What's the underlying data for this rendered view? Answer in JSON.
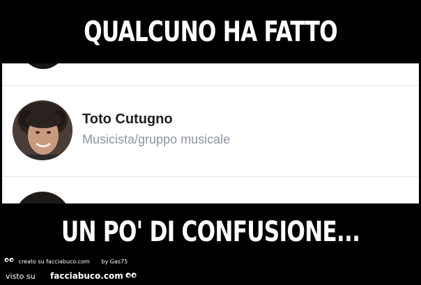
{
  "meme": {
    "top_caption": "QUALCUNO HA FATTO",
    "bottom_caption": "UN PO' DI CONFUSIONE..."
  },
  "profile": {
    "name": "Toto Cutugno",
    "category": "Musicista/gruppo musicale"
  },
  "footer": {
    "created_on": "creato su facciabuco.com",
    "by": "by Gas75",
    "seen_on": "visto su",
    "site": "facciabuco.com"
  },
  "icons": {
    "watermark_eyes": "eyes-icon"
  },
  "colors": {
    "background": "#000000",
    "caption_text": "#ffffff",
    "name_text": "#1c1e21",
    "category_text": "#8d949e",
    "divider": "#e4e6e9"
  }
}
